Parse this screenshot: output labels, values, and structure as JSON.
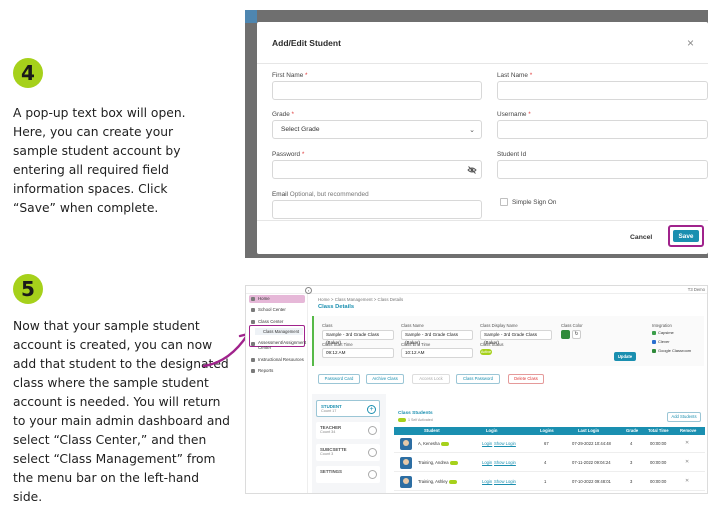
{
  "steps": [
    {
      "number": "4",
      "text": "A pop-up text box will open. Here, you can create your sample student account by entering all required field information spaces. Click “Save” when complete."
    },
    {
      "number": "5",
      "text": "Now that your sample student account is created, you can now add that student to the designated class where the sample student account is needed. You will return to your main admin dashboard and select “Class Center,” and then select “Class Management” from the menu bar on the left-hand side."
    }
  ],
  "modal": {
    "title": "Add/Edit Student",
    "close": "×",
    "first_name_label": "First Name",
    "last_name_label": "Last Name",
    "grade_label": "Grade",
    "grade_value": "Select Grade",
    "username_label": "Username",
    "password_label": "Password",
    "student_id_label": "Student Id",
    "email_label": "Email",
    "email_hint": "Optional, but recommended",
    "required_mark": "*",
    "sso_label": "Simple Sign On",
    "cancel": "Cancel",
    "save": "Save"
  },
  "dashboard": {
    "user": "T3 Demo",
    "sidebar": {
      "home": "Home",
      "school_center": "School Center",
      "class_center": "Class Center",
      "class_management": "Class Management",
      "assessment_center": "Assessment/Assignment Center",
      "instructional_resources": "Instructional Resources",
      "reports": "Reports"
    },
    "breadcrumb": "Home  >  Class Management  >  Class Details",
    "page_title": "Class Details",
    "form": {
      "class_label": "Class",
      "class_value": "Sample - 3rd Grade Class (Baker)",
      "class_name_label": "Class Name",
      "class_name_value": "Sample - 3rd Grade Class (Baker)",
      "display_name_label": "Class Display Name",
      "display_name_value": "Sample - 3rd Grade Class (Baker)",
      "class_color_label": "Class Color",
      "start_label": "Class Start Time",
      "start_value": "09:12 AM",
      "end_label": "Class End Time",
      "end_value": "10:12 AM",
      "status_label": "Class Status",
      "status_value": "Active",
      "update": "Update",
      "integration_label": "Integration",
      "integrations": [
        "Capsime",
        "Clever",
        "Google Classroom"
      ]
    },
    "actions": [
      "Password Card",
      "Archive Class",
      "Access Lock",
      "Class Password",
      "Delete Class"
    ],
    "roles": [
      {
        "title": "STUDENT",
        "sub": "Count 17"
      },
      {
        "title": "TEACHER",
        "sub": "Count 34"
      },
      {
        "title": "SUBCSETTE",
        "sub": "Count 3"
      },
      {
        "title": "SETTINGS",
        "sub": ""
      }
    ],
    "students": {
      "title": "Class Students",
      "count_text": "1 Self Activated",
      "add": "Add Students",
      "headers": [
        "Student",
        "Login",
        "Logins",
        "Last Login",
        "Grade",
        "Total Time",
        "Remove"
      ],
      "rows": [
        {
          "name": "A, Kenesha",
          "login": "Login",
          "show": "Show Login",
          "logins": "67",
          "last": "07-29-2022 10:44:48",
          "grade": "4",
          "time": "00:00:00"
        },
        {
          "name": "Training, Andrea",
          "login": "Login",
          "show": "Show Login",
          "logins": "4",
          "last": "07-11-2022 09:04:24",
          "grade": "3",
          "time": "00:00:00"
        },
        {
          "name": "Training, Ashley",
          "login": "Login",
          "show": "Show Login",
          "logins": "1",
          "last": "07-10-2022 09:48:01",
          "grade": "3",
          "time": "00:00:00"
        }
      ]
    }
  },
  "colors": {
    "accent_green": "#a6d11b",
    "highlight_magenta": "#a0238c",
    "primary_blue": "#1a8fb0"
  }
}
